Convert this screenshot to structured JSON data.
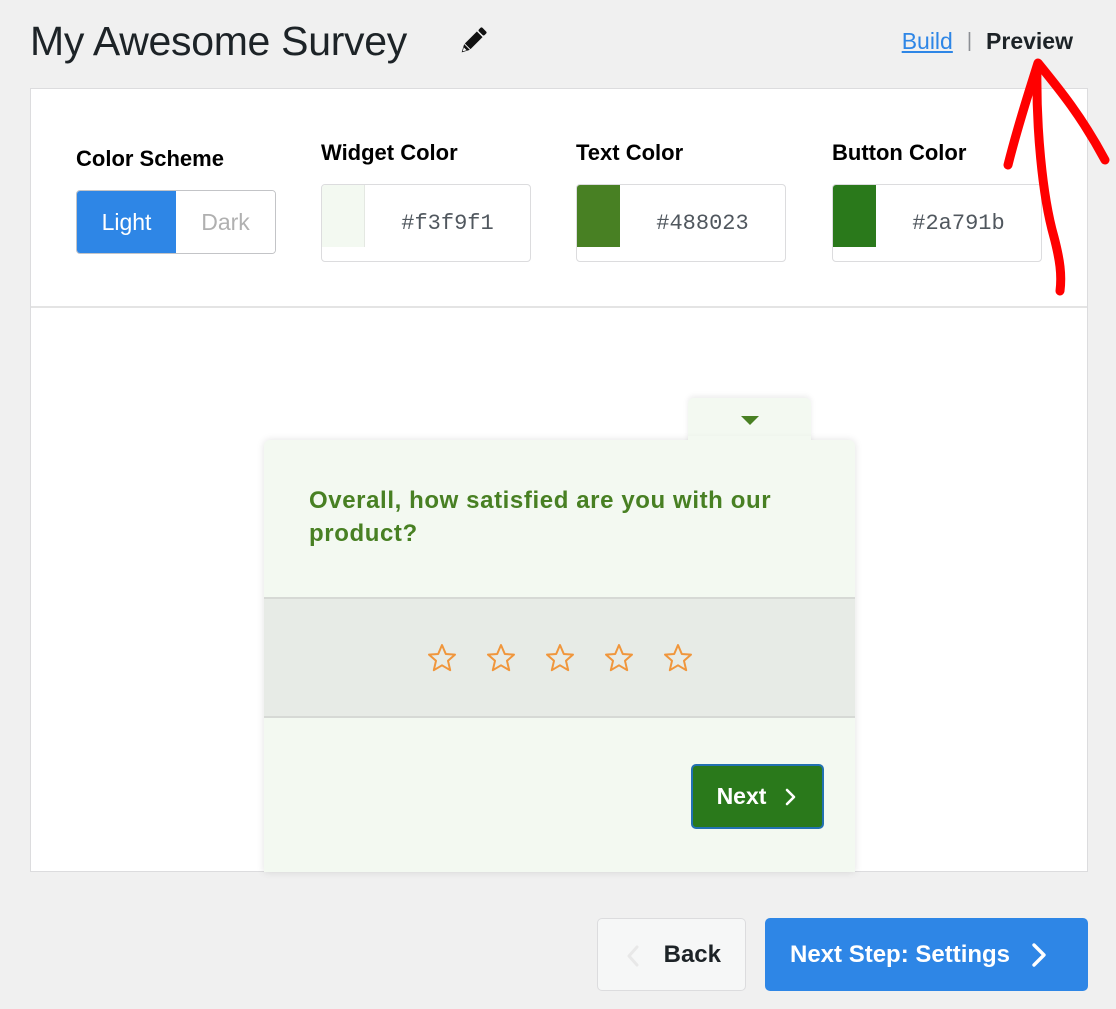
{
  "header": {
    "title": "My Awesome Survey",
    "edit_icon": "pencil-icon",
    "view_switch": {
      "build_label": "Build",
      "separator": "|",
      "preview_label": "Preview",
      "active": "Preview"
    }
  },
  "settings": {
    "color_scheme": {
      "label": "Color Scheme",
      "options": [
        "Light",
        "Dark"
      ],
      "selected": "Light"
    },
    "widget_color": {
      "label": "Widget Color",
      "value": "#f3f9f1"
    },
    "text_color": {
      "label": "Text Color",
      "value": "#488023"
    },
    "button_color": {
      "label": "Button Color",
      "value": "#2a791b"
    }
  },
  "preview": {
    "collapse_icon": "caret-down-icon",
    "question": "Overall, how satisfied are you with our product?",
    "rating": {
      "max_stars": 5,
      "selected": 0,
      "star_color": "#f0963c",
      "icon": "star-outline-icon"
    },
    "next_label": "Next",
    "next_icon": "chevron-right-icon",
    "rating_band_color": "#e7ebe6"
  },
  "footer": {
    "back_label": "Back",
    "back_icon": "chevron-left-icon",
    "next_step_label": "Next Step: Settings",
    "next_step_icon": "chevron-right-icon",
    "accent_color": "#2e86e6"
  },
  "annotation": {
    "type": "hand-drawn-arrow",
    "points_to": "Preview",
    "color": "#ff0000"
  }
}
